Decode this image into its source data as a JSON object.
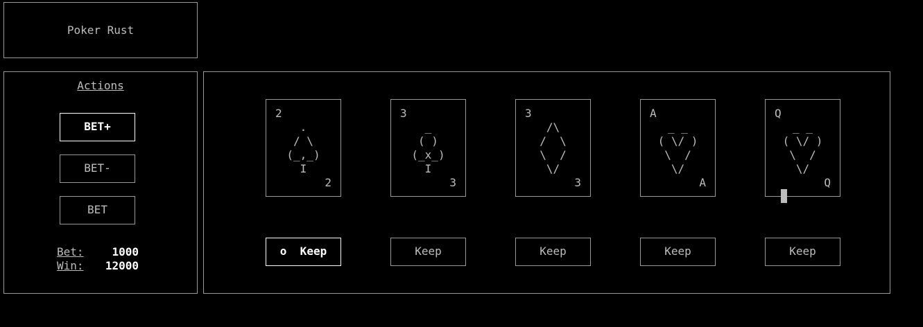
{
  "title": "Poker Rust",
  "actions": {
    "heading": "Actions",
    "bet_plus": "BET+",
    "bet_minus": "BET-",
    "bet": "BET",
    "bet_label": "Bet:",
    "bet_value": "1000",
    "win_label": "Win:",
    "win_value": "12000"
  },
  "cards": [
    {
      "rank": "2",
      "suit": "clubs",
      "art": "  .  \n / \\ \n(_,_)\n  I  "
    },
    {
      "rank": "3",
      "suit": "spades",
      "art": "  _  \n ( ) \n(_x_)\n  I  "
    },
    {
      "rank": "3",
      "suit": "diamonds",
      "art": " /\\ \n/  \\\n\\  /\n \\/ "
    },
    {
      "rank": "A",
      "suit": "hearts",
      "art": " _ _ \n( \\/ )\n \\  / \n  \\/  "
    },
    {
      "rank": "Q",
      "suit": "hearts",
      "art": " _ _ \n( \\/ )\n \\  / \n  \\/  "
    }
  ],
  "keep_buttons": [
    "o  Keep",
    "Keep",
    "Keep",
    "Keep",
    "Keep"
  ]
}
